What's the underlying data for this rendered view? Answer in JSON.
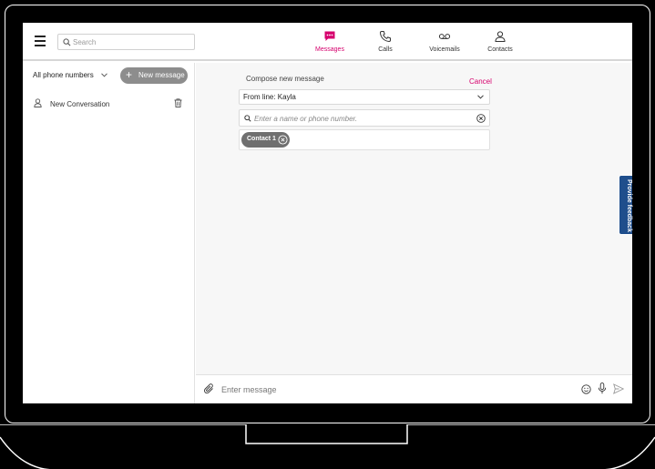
{
  "header": {
    "search_placeholder": "Search",
    "tabs": [
      {
        "label": "Messages",
        "icon": "message-icon",
        "active": true
      },
      {
        "label": "Calls",
        "icon": "phone-icon",
        "active": false
      },
      {
        "label": "Voicemails",
        "icon": "voicemail-icon",
        "active": false
      },
      {
        "label": "Contacts",
        "icon": "contacts-icon",
        "active": false
      }
    ]
  },
  "sidebar": {
    "filter_label": "All phone numbers",
    "new_message_label": "New message",
    "conversations": [
      {
        "label": "New Conversation"
      }
    ]
  },
  "compose": {
    "title": "Compose new message",
    "cancel_label": "Cancel",
    "from_line": "From line: Kayla",
    "recipient_placeholder": "Enter a name or phone number.",
    "chips": [
      {
        "label": "Contact 1"
      }
    ]
  },
  "composer": {
    "placeholder": "Enter message"
  },
  "feedback": {
    "label": "Provide feedback"
  },
  "colors": {
    "accent": "#d6006d",
    "feedback_bg": "#1f4e8c",
    "button_gray": "#8d8d8d",
    "chip_gray": "#6f6f6f"
  }
}
